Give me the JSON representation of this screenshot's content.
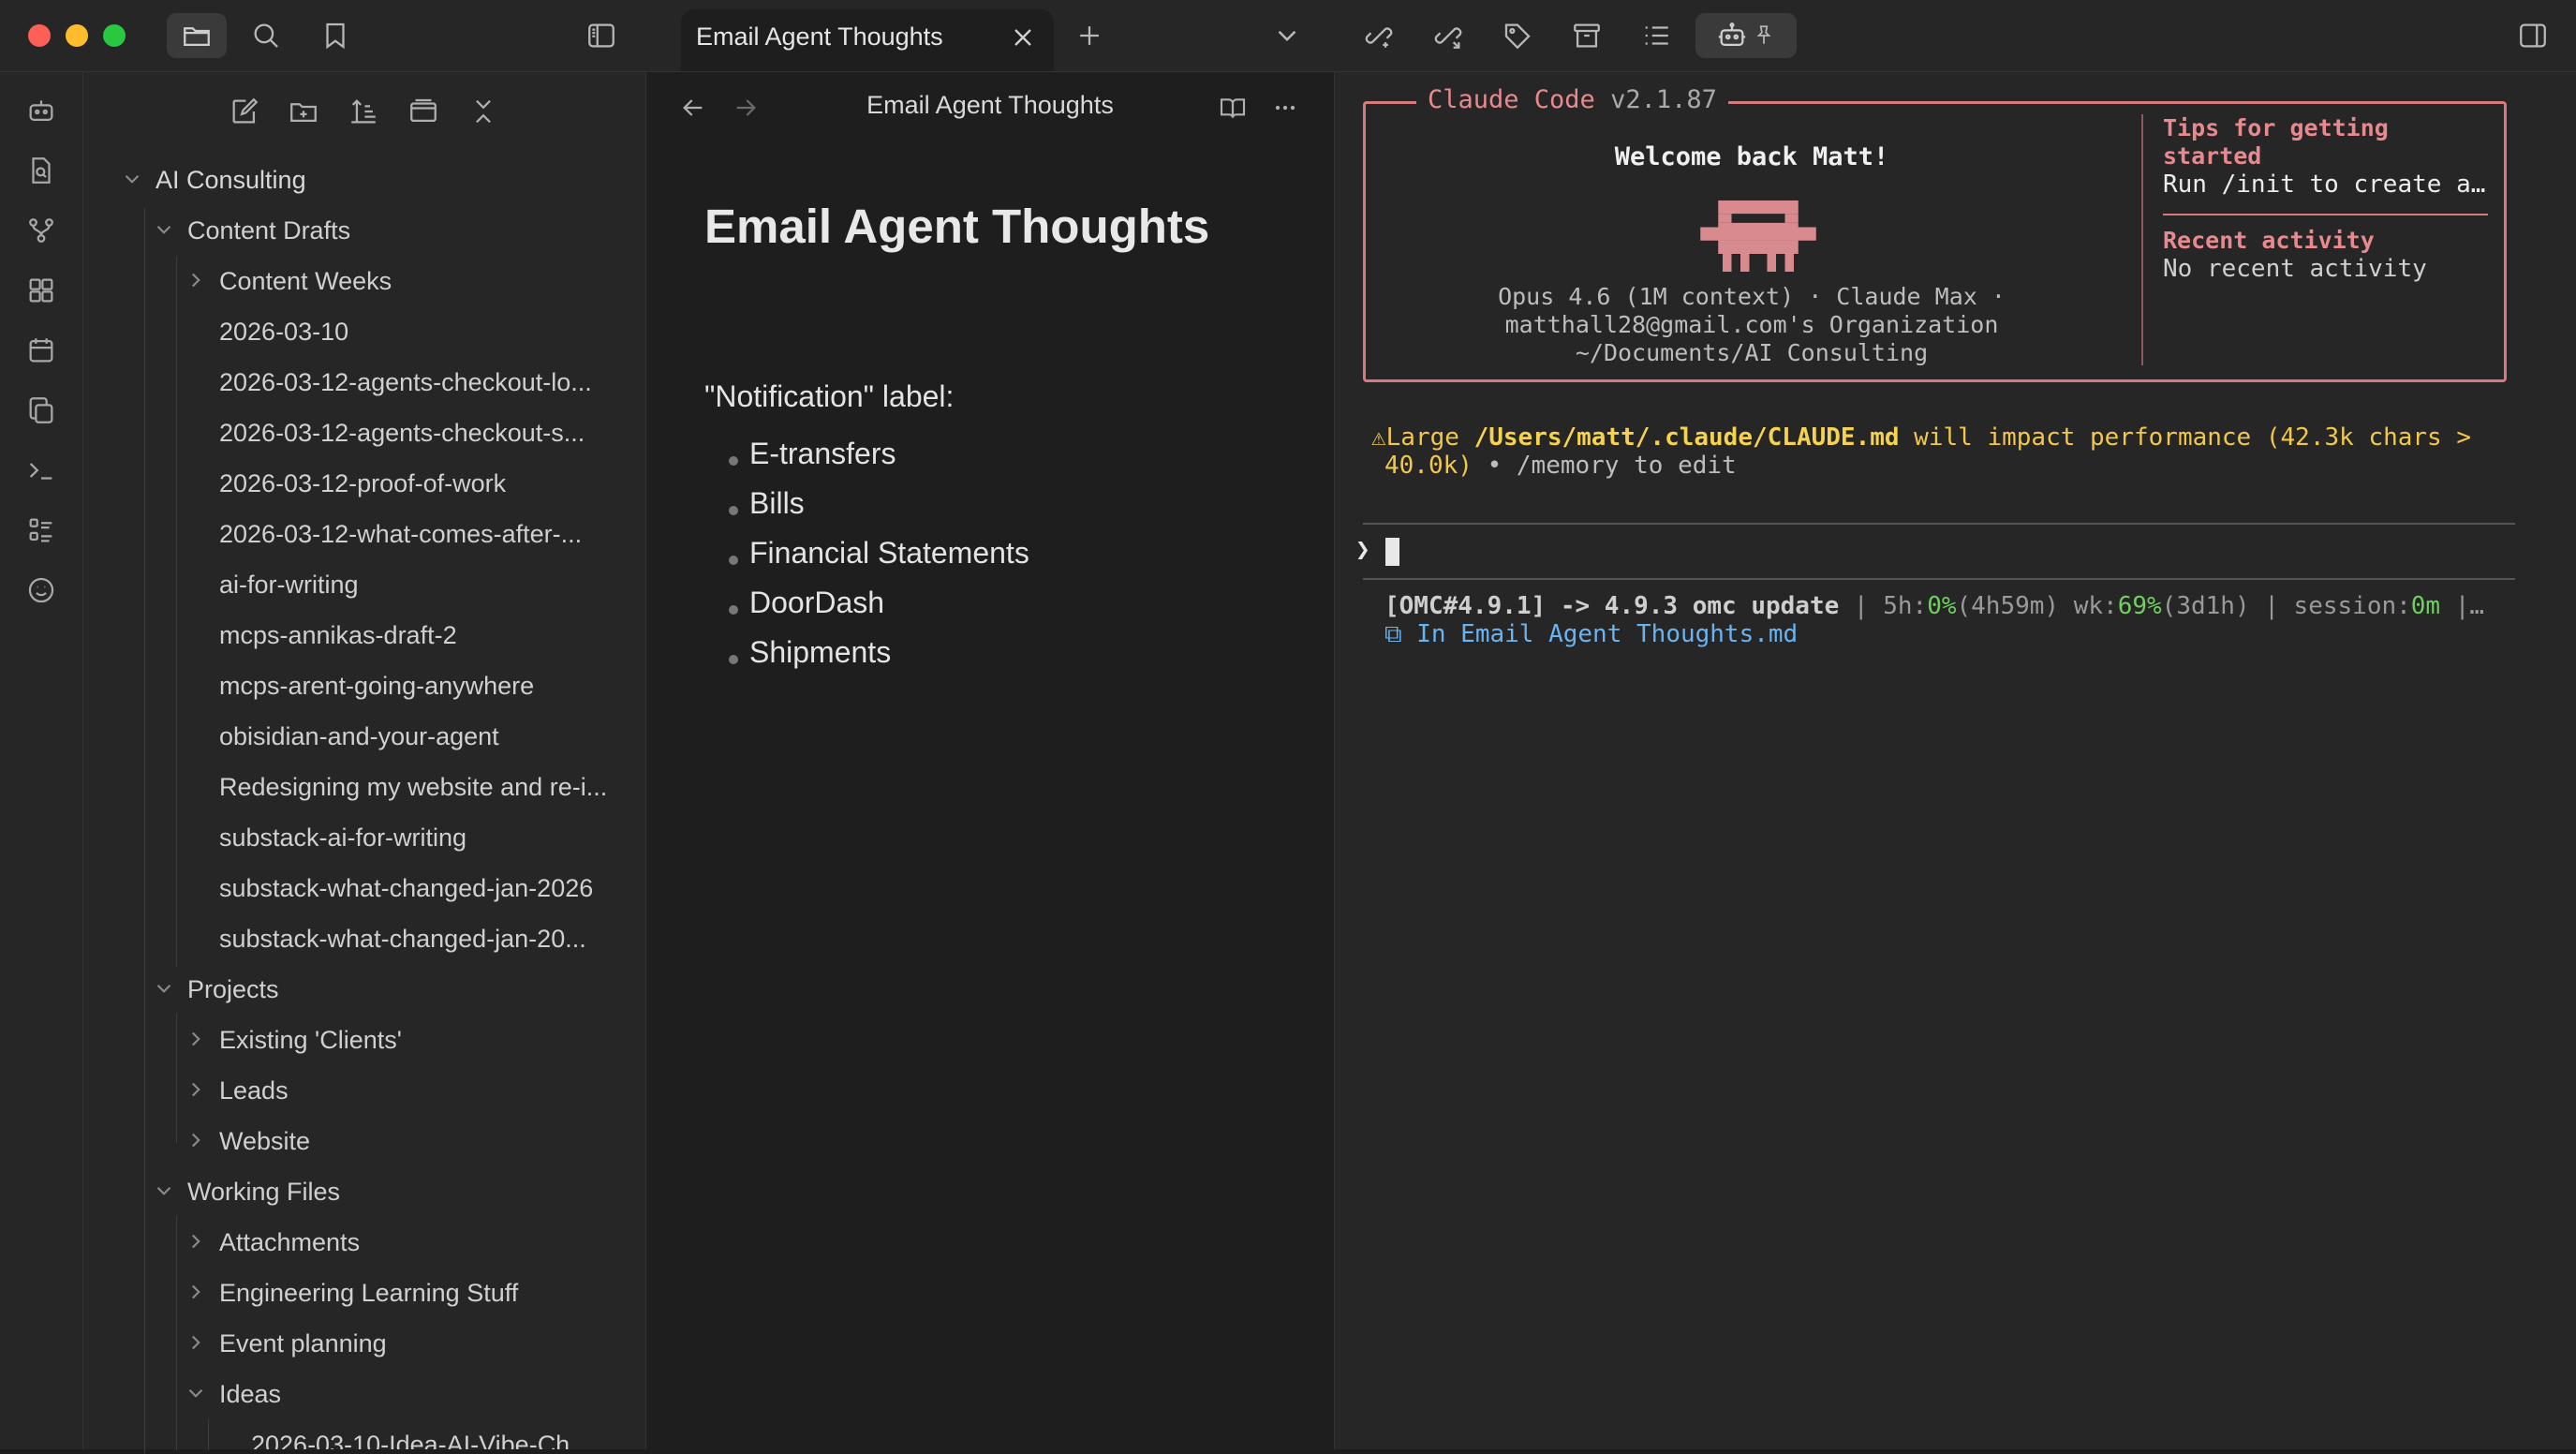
{
  "window": {
    "active_tab_title": "Email Agent Thoughts"
  },
  "sidebar": {
    "tree": [
      {
        "label": "AI Consulting",
        "depth": 0,
        "chevron": "down"
      },
      {
        "label": "Content Drafts",
        "depth": 1,
        "chevron": "down"
      },
      {
        "label": "Content Weeks",
        "depth": 2,
        "chevron": "right"
      },
      {
        "label": "2026-03-10",
        "depth": 2,
        "chevron": "none"
      },
      {
        "label": "2026-03-12-agents-checkout-lo...",
        "depth": 2,
        "chevron": "none"
      },
      {
        "label": "2026-03-12-agents-checkout-s...",
        "depth": 2,
        "chevron": "none"
      },
      {
        "label": "2026-03-12-proof-of-work",
        "depth": 2,
        "chevron": "none"
      },
      {
        "label": "2026-03-12-what-comes-after-...",
        "depth": 2,
        "chevron": "none"
      },
      {
        "label": "ai-for-writing",
        "depth": 2,
        "chevron": "none"
      },
      {
        "label": "mcps-annikas-draft-2",
        "depth": 2,
        "chevron": "none"
      },
      {
        "label": "mcps-arent-going-anywhere",
        "depth": 2,
        "chevron": "none"
      },
      {
        "label": "obisidian-and-your-agent",
        "depth": 2,
        "chevron": "none"
      },
      {
        "label": "Redesigning my website and re-i...",
        "depth": 2,
        "chevron": "none"
      },
      {
        "label": "substack-ai-for-writing",
        "depth": 2,
        "chevron": "none"
      },
      {
        "label": "substack-what-changed-jan-2026",
        "depth": 2,
        "chevron": "none"
      },
      {
        "label": "substack-what-changed-jan-20...",
        "depth": 2,
        "chevron": "none"
      },
      {
        "label": "Projects",
        "depth": 1,
        "chevron": "down"
      },
      {
        "label": "Existing 'Clients'",
        "depth": 2,
        "chevron": "right"
      },
      {
        "label": "Leads",
        "depth": 2,
        "chevron": "right"
      },
      {
        "label": "Website",
        "depth": 2,
        "chevron": "right"
      },
      {
        "label": "Working Files",
        "depth": 1,
        "chevron": "down"
      },
      {
        "label": "Attachments",
        "depth": 2,
        "chevron": "right"
      },
      {
        "label": "Engineering Learning Stuff",
        "depth": 2,
        "chevron": "right"
      },
      {
        "label": "Event planning",
        "depth": 2,
        "chevron": "right"
      },
      {
        "label": "Ideas",
        "depth": 2,
        "chevron": "down"
      },
      {
        "label": "2026-03-10-Idea-AI-Vibe-Ch...",
        "depth": 3,
        "chevron": "none"
      }
    ]
  },
  "note": {
    "header_title": "Email Agent Thoughts",
    "title": "Email Agent Thoughts",
    "label_line": "\"Notification\" label:",
    "bullets": [
      "E-transfers",
      "Bills",
      "Financial Statements",
      "DoorDash",
      "Shipments"
    ]
  },
  "terminal": {
    "box_title": "Claude Code",
    "box_version": "v2.1.87",
    "welcome": "Welcome back Matt!",
    "model_line": "Opus 4.6 (1M context) · Claude Max ·",
    "org_line": "matthall28@gmail.com's Organization",
    "path_line": "~/Documents/AI Consulting",
    "tips_title_1": "Tips for getting",
    "tips_title_2": "started",
    "tips_text": "Run /init to create a…",
    "recent_title": "Recent activity",
    "recent_text": "No recent activity",
    "warn_prefix": "⚠Large ",
    "warn_path": "/Users/matt/.claude/CLAUDE.md",
    "warn_rest": " will impact performance (42.3k chars >",
    "warn_line2_a": "40.0k)",
    "warn_line2_b": " • /memory to edit",
    "prompt": "❯",
    "status": {
      "omc": "[OMC#4.9.1] -> 4.9.3 omc update",
      "sep1": " | 5h:",
      "five_h_pct": "0%",
      "five_h_time": "(4h59m)",
      "wk_label": " wk:",
      "wk_pct": "69%",
      "wk_time": "(3d1h)",
      "session_label": " | session:",
      "session_val": "0m",
      "tail": " |…"
    },
    "context_file": "⧉ In Email Agent Thoughts.md"
  },
  "colors": {
    "accent_claude": "#d77a80",
    "warning": "#f2c84b",
    "status_green": "#6fcf5f",
    "link_blue": "#6ab3f0"
  }
}
